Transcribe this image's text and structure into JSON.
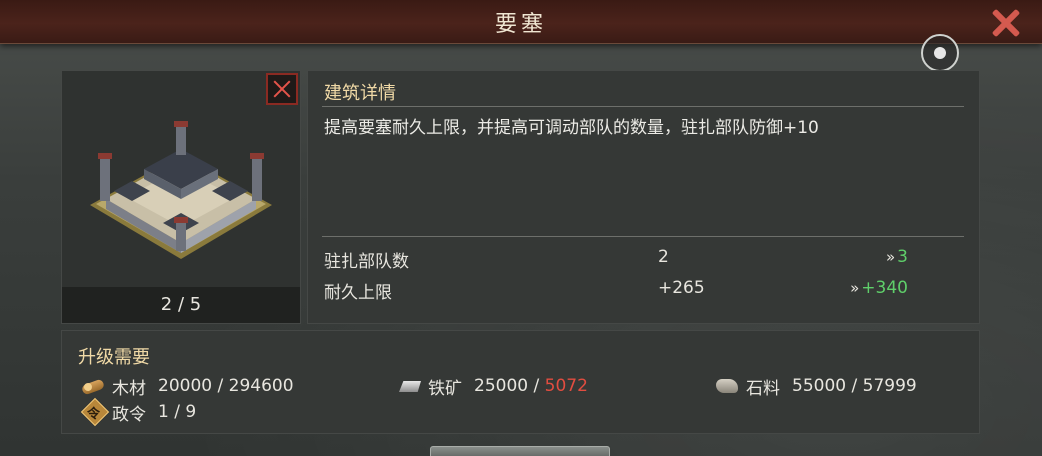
{
  "window": {
    "title": "要塞"
  },
  "building": {
    "level": "2 / 5",
    "icon": "fortress-image"
  },
  "detail": {
    "heading": "建筑详情",
    "description": "提高要塞耐久上限，并提高可调动部队的数量，驻扎部队防御+10",
    "stats": [
      {
        "label": "驻扎部队数",
        "current": "2",
        "next": "3"
      },
      {
        "label": "耐久上限",
        "current": "+265",
        "next": "+340"
      }
    ],
    "arrow_glyph": "»"
  },
  "requirements": {
    "heading": "升级需要",
    "resources": [
      {
        "icon": "wood-icon",
        "name": "木材",
        "have": "20000",
        "need": "294600",
        "sufficient": true
      },
      {
        "icon": "iron-icon",
        "name": "铁矿",
        "have": "25000",
        "need": "5072",
        "sufficient": false
      },
      {
        "icon": "stone-icon",
        "name": "石料",
        "have": "55000",
        "need": "57999",
        "sufficient": true
      },
      {
        "icon": "order-icon",
        "name": "政令",
        "have": "1",
        "need": "9",
        "sufficient": true
      }
    ],
    "order_glyph": "令"
  },
  "colors": {
    "next_value": "#5fcf6a",
    "warning": "#e24d40",
    "heading": "#f0d9a6",
    "close": "#d45a4f"
  }
}
